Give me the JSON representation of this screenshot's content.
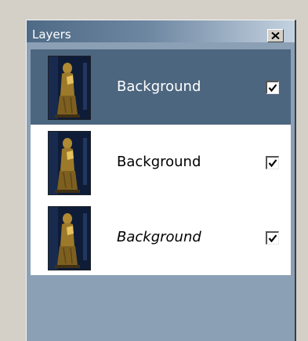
{
  "panel": {
    "title": "Layers",
    "close_icon": "close-x-icon"
  },
  "layers": [
    {
      "name": "Background",
      "visible": true,
      "selected": true,
      "italic": false,
      "thumbnail": "statue-thumbnail"
    },
    {
      "name": "Background",
      "visible": true,
      "selected": false,
      "italic": false,
      "thumbnail": "statue-thumbnail"
    },
    {
      "name": "Background",
      "visible": true,
      "selected": false,
      "italic": true,
      "thumbnail": "statue-thumbnail"
    }
  ],
  "colors": {
    "title_bar": "#4f6a86",
    "selected_row": "#4d6680",
    "panel_body": "#8b9fb5"
  }
}
